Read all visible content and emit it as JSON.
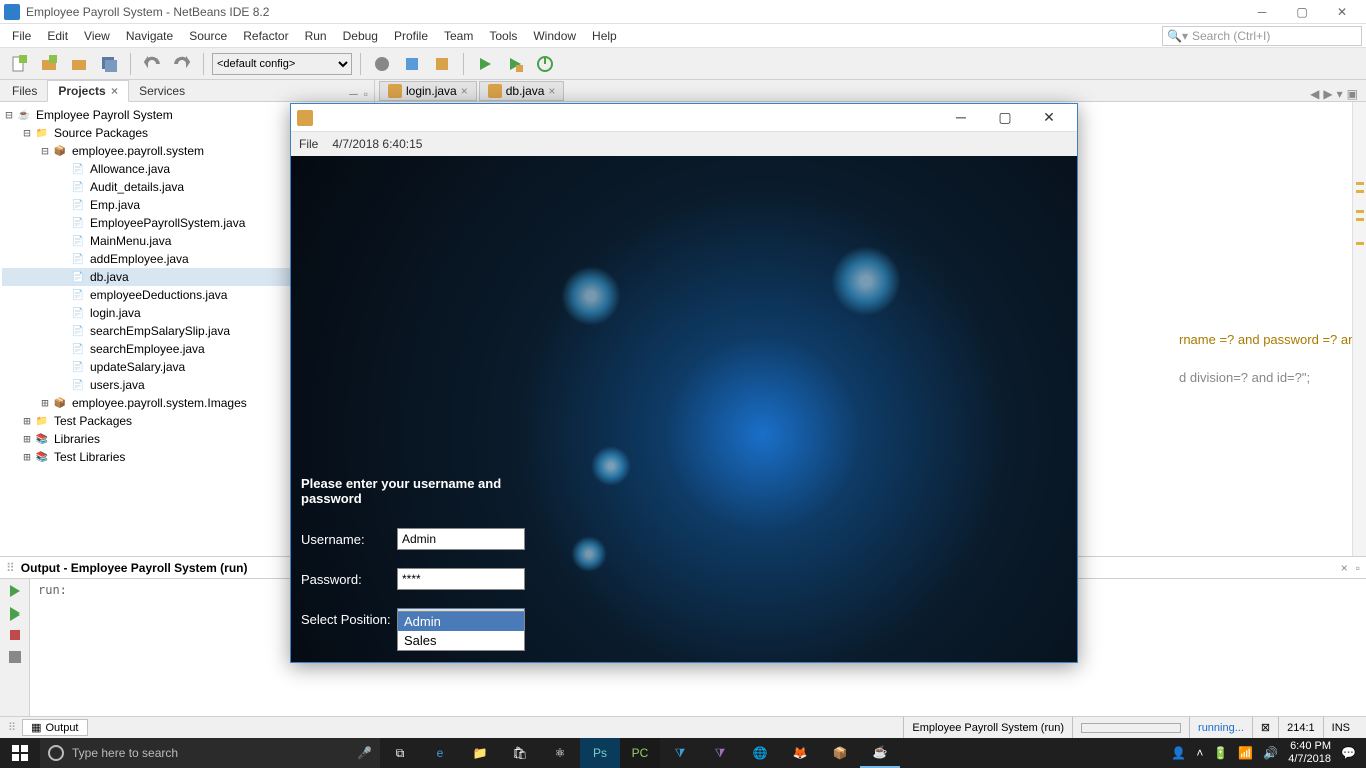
{
  "window": {
    "title": "Employee Payroll System - NetBeans IDE 8.2"
  },
  "menu": [
    "File",
    "Edit",
    "View",
    "Navigate",
    "Source",
    "Refactor",
    "Run",
    "Debug",
    "Profile",
    "Team",
    "Tools",
    "Window",
    "Help"
  ],
  "search_placeholder": "Search (Ctrl+I)",
  "toolbar": {
    "config_label": "<default config>"
  },
  "left_tabs": [
    "Files",
    "Projects",
    "Services"
  ],
  "left_tabs_active": 1,
  "project": {
    "root": "Employee Payroll System",
    "source_pkg": "Source Packages",
    "pkg1": "employee.payroll.system",
    "files": [
      "Allowance.java",
      "Audit_details.java",
      "Emp.java",
      "EmployeePayrollSystem.java",
      "MainMenu.java",
      "addEmployee.java",
      "db.java",
      "employeeDeductions.java",
      "login.java",
      "searchEmpSalarySlip.java",
      "searchEmployee.java",
      "updateSalary.java",
      "users.java"
    ],
    "pkg2": "employee.payroll.system.Images",
    "test_pkg": "Test Packages",
    "libraries": "Libraries",
    "test_lib": "Test Libraries",
    "selected": "db.java"
  },
  "editor_tabs": [
    {
      "label": "login.java"
    },
    {
      "label": "db.java"
    }
  ],
  "editor_fragments": [
    "rname =? and password =? and div",
    "d division=? and id=?\";"
  ],
  "output": {
    "title": "Output - Employee Payroll System (run)",
    "text": "run:"
  },
  "status": {
    "output_tab": "Output",
    "run_label": "Employee Payroll System (run)",
    "running": "running...",
    "cursor": "214:1",
    "ins": "INS"
  },
  "login": {
    "menu_file": "File",
    "timestamp": "4/7/2018   6:40:15",
    "heading": "Please enter your username and password",
    "username_label": "Username:",
    "username_value": "Admin",
    "password_label": "Password:",
    "password_value": "****",
    "position_label": "Select Position:",
    "position_value": "Admin",
    "options": [
      "Admin",
      "Sales"
    ],
    "option_selected": 0
  },
  "taskbar": {
    "search_placeholder": "Type here to search",
    "time": "6:40 PM",
    "date": "4/7/2018"
  }
}
